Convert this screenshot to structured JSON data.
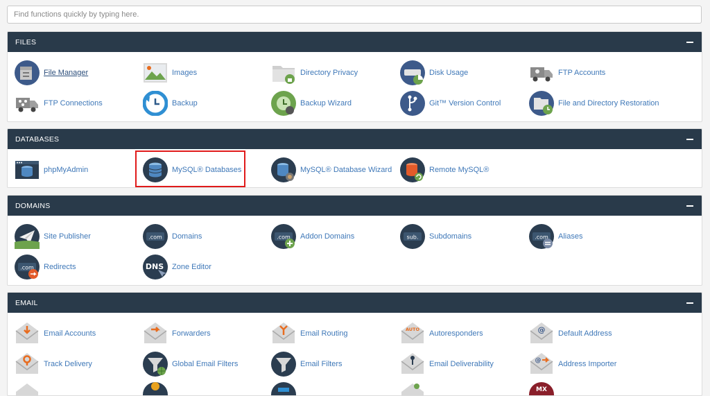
{
  "search": {
    "placeholder": "Find functions quickly by typing here."
  },
  "colors": {
    "header_bg": "#293a4a",
    "link": "#3f78b8",
    "highlight": "#e01a1a"
  },
  "sections": {
    "files": {
      "title": "FILES",
      "items": [
        {
          "label": "File Manager",
          "icon": "file-manager-icon"
        },
        {
          "label": "Images",
          "icon": "images-icon"
        },
        {
          "label": "Directory Privacy",
          "icon": "directory-privacy-icon"
        },
        {
          "label": "Disk Usage",
          "icon": "disk-usage-icon"
        },
        {
          "label": "FTP Accounts",
          "icon": "ftp-accounts-icon"
        },
        {
          "label": "FTP Connections",
          "icon": "ftp-connections-icon"
        },
        {
          "label": "Backup",
          "icon": "backup-icon"
        },
        {
          "label": "Backup Wizard",
          "icon": "backup-wizard-icon"
        },
        {
          "label": "Git™ Version Control",
          "icon": "git-icon"
        },
        {
          "label": "File and Directory Restoration",
          "icon": "restore-icon"
        }
      ]
    },
    "databases": {
      "title": "DATABASES",
      "items": [
        {
          "label": "phpMyAdmin",
          "icon": "phpmyadmin-icon"
        },
        {
          "label": "MySQL® Databases",
          "icon": "mysql-databases-icon"
        },
        {
          "label": "MySQL® Database Wizard",
          "icon": "mysql-wizard-icon"
        },
        {
          "label": "Remote MySQL®",
          "icon": "remote-mysql-icon"
        }
      ]
    },
    "domains": {
      "title": "DOMAINS",
      "items": [
        {
          "label": "Site Publisher",
          "icon": "site-publisher-icon"
        },
        {
          "label": "Domains",
          "icon": "domains-icon",
          "badge": ".com"
        },
        {
          "label": "Addon Domains",
          "icon": "addon-domains-icon",
          "badge": ".com"
        },
        {
          "label": "Subdomains",
          "icon": "subdomains-icon",
          "badge": "sub."
        },
        {
          "label": "Aliases",
          "icon": "aliases-icon",
          "badge": ".com"
        },
        {
          "label": "Redirects",
          "icon": "redirects-icon",
          "badge": ".com"
        },
        {
          "label": "Zone Editor",
          "icon": "zone-editor-icon",
          "badge": "DNS"
        }
      ]
    },
    "email": {
      "title": "EMAIL",
      "items": [
        {
          "label": "Email Accounts",
          "icon": "email-accounts-icon"
        },
        {
          "label": "Forwarders",
          "icon": "forwarders-icon"
        },
        {
          "label": "Email Routing",
          "icon": "email-routing-icon"
        },
        {
          "label": "Autoresponders",
          "icon": "autoresponders-icon",
          "badge": "AUTO"
        },
        {
          "label": "Default Address",
          "icon": "default-address-icon",
          "badge": "@"
        },
        {
          "label": "Track Delivery",
          "icon": "track-delivery-icon"
        },
        {
          "label": "Global Email Filters",
          "icon": "global-filters-icon"
        },
        {
          "label": "Email Filters",
          "icon": "email-filters-icon"
        },
        {
          "label": "Email Deliverability",
          "icon": "deliverability-icon"
        },
        {
          "label": "Address Importer",
          "icon": "address-importer-icon",
          "badge": "@"
        }
      ],
      "partial_icons": [
        {
          "icon": "mail-icon"
        },
        {
          "icon": "globe-icon"
        },
        {
          "icon": "blue-icon"
        },
        {
          "icon": "mail-icon"
        },
        {
          "icon": "mx-icon",
          "badge": "MX"
        }
      ]
    }
  }
}
